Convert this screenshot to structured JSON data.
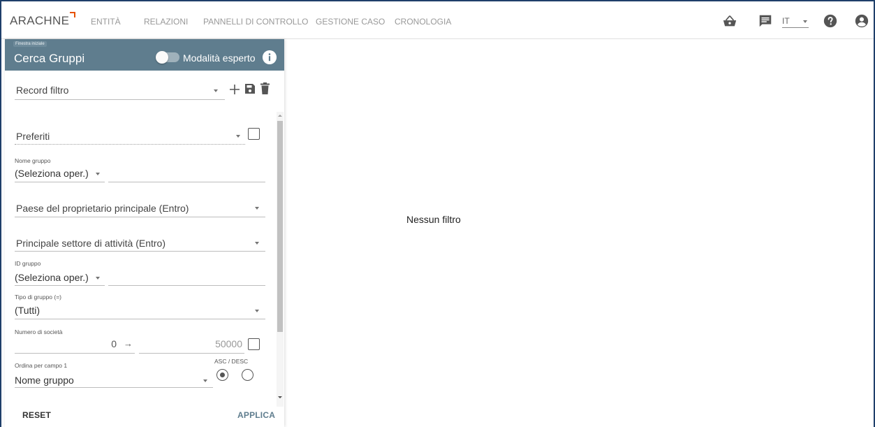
{
  "app": {
    "logo": "ARACHNE",
    "accent_color": "#e65100",
    "header_color": "#5f7d8e"
  },
  "nav": {
    "items": [
      {
        "label": "ENTITÀ"
      },
      {
        "label": "RELAZIONI"
      },
      {
        "label": "PANNELLI DI CONTROLLO"
      },
      {
        "label": "GESTIONE CASO"
      },
      {
        "label": "CRONOLOGIA"
      }
    ]
  },
  "topbar": {
    "icons": [
      "basket-icon",
      "comment-icon",
      "help-icon",
      "user-icon"
    ],
    "language": "IT"
  },
  "panel": {
    "window_badge": "Finestra iniziale",
    "title": "Cerca Gruppi",
    "expert_mode_label": "Modalità esperto",
    "expert_mode_on": false,
    "record_filter": {
      "placeholder": "Record filtro"
    },
    "favorites": {
      "placeholder": "Preferiti",
      "checked": false
    },
    "group_name": {
      "label": "Nome gruppo",
      "operator": "(Seleziona oper.)",
      "value": ""
    },
    "owner_country": {
      "placeholder": "Paese del proprietario principale (Entro)"
    },
    "main_sector": {
      "placeholder": "Principale settore di attività (Entro)"
    },
    "group_id": {
      "label": "ID gruppo",
      "operator": "(Seleziona oper.)",
      "value": ""
    },
    "group_type": {
      "label": "Tipo di gruppo (=)",
      "value": "(Tutti)"
    },
    "company_count": {
      "label": "Numero di società",
      "from": "0",
      "arrow": "→",
      "to": "50000",
      "checked": false
    },
    "sort": {
      "label": "Ordina per campo 1",
      "asc_desc_label": "ASC / DESC",
      "value": "Nome gruppo",
      "order": "ASC"
    },
    "reset_label": "RESET",
    "apply_label": "APPLICA"
  },
  "main": {
    "empty_message": "Nessun filtro"
  }
}
